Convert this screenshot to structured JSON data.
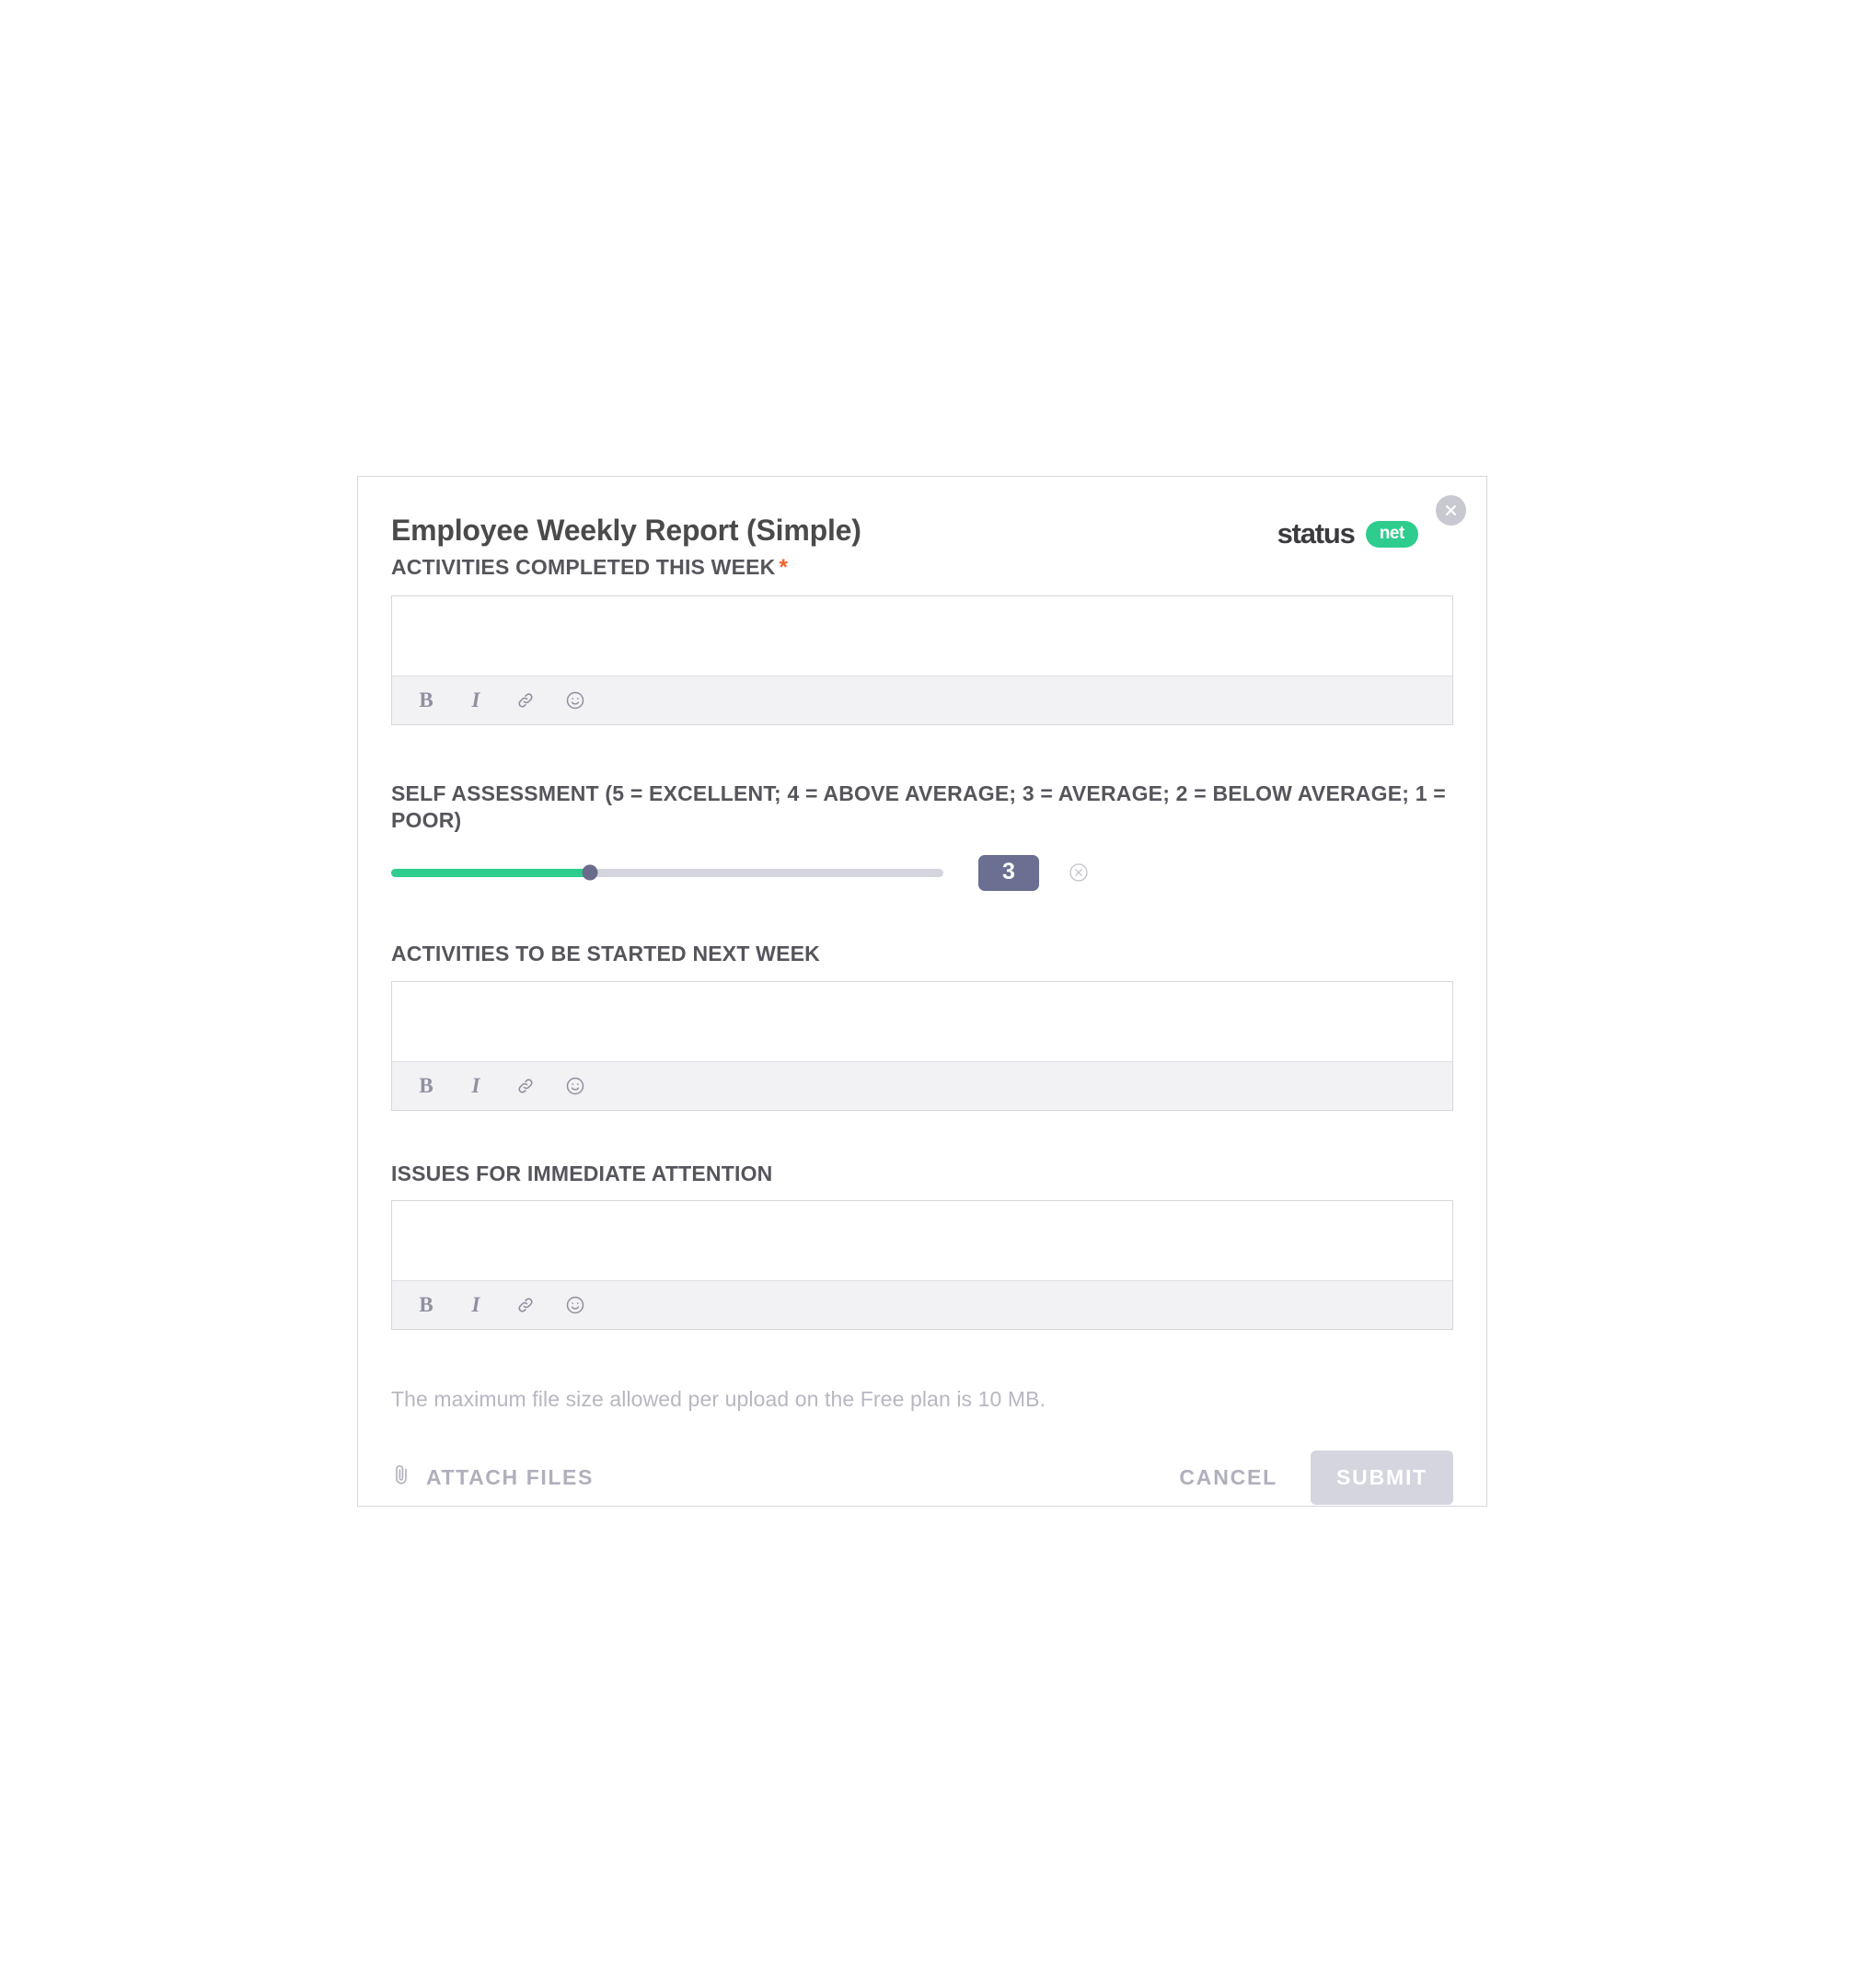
{
  "modal": {
    "title": "Employee Weekly Report (Simple)",
    "close_icon": "close-icon"
  },
  "brand": {
    "word": "status",
    "pill": "net",
    "pill_color": "#2ecd8e"
  },
  "editor_toolbar": {
    "bold": "B",
    "italic": "I",
    "link_icon": "link-icon",
    "emoji_icon": "emoji-icon"
  },
  "fields": {
    "activities_completed": {
      "label": "ACTIVITIES COMPLETED THIS WEEK",
      "required_marker": "*",
      "value": "",
      "placeholder": ""
    },
    "self_assessment": {
      "label": "SELF ASSESSMENT (5 = EXCELLENT; 4 = ABOVE AVERAGE; 3 = AVERAGE; 2 = BELOW AVERAGE; 1 = POOR)",
      "value": "3",
      "min": 1,
      "max": 5,
      "fill_percent": 36,
      "fill_color": "#2ecd8e",
      "badge_color": "#6b6f92",
      "clear_icon": "clear-circle-icon"
    },
    "activities_next_week": {
      "label": "ACTIVITIES TO BE STARTED NEXT WEEK",
      "value": "",
      "placeholder": ""
    },
    "issues_attention": {
      "label": "ISSUES FOR IMMEDIATE ATTENTION",
      "value": "",
      "placeholder": ""
    }
  },
  "footer": {
    "note": "The maximum file size allowed per upload on the Free plan is 10 MB.",
    "attach_label": "ATTACH FILES",
    "attach_icon": "paperclip-icon",
    "cancel_label": "CANCEL",
    "submit_label": "SUBMIT"
  }
}
